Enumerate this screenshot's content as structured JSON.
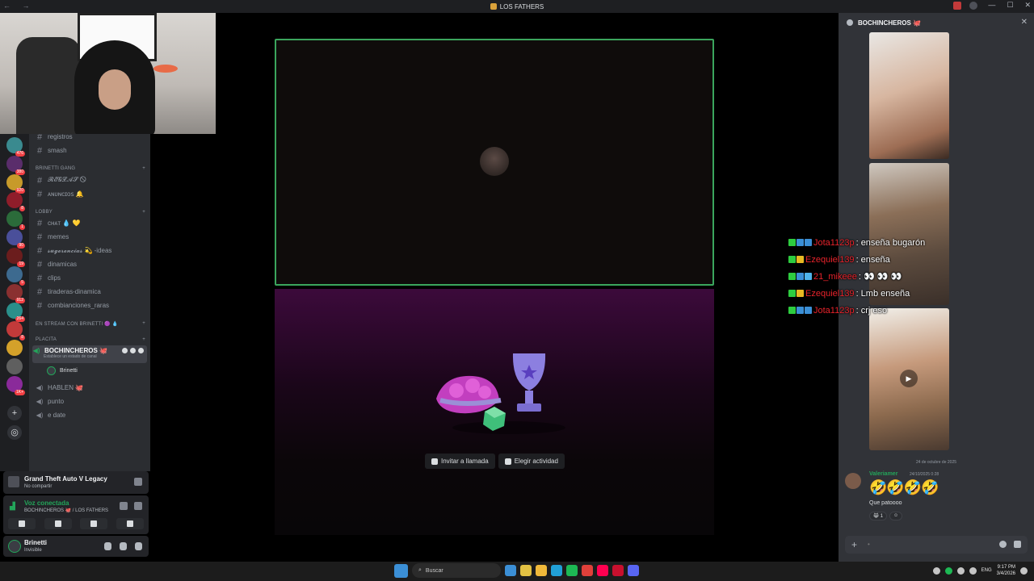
{
  "window": {
    "title": "LOS FATHERS"
  },
  "servers": [
    {
      "color": "#3a8a8f",
      "count": "476"
    },
    {
      "color": "#5a2d6b",
      "count": "380"
    },
    {
      "color": "#c79a2a",
      "count": "920"
    },
    {
      "color": "#8f1d2a",
      "count": "8"
    },
    {
      "color": "#2b6b3a",
      "count": "1"
    },
    {
      "color": "#4a4f9a",
      "count": "90"
    },
    {
      "color": "#6b1d1d",
      "count": "19"
    },
    {
      "color": "#3d6a8f",
      "count": "5"
    },
    {
      "color": "#8a3030",
      "count": "912"
    },
    {
      "color": "#2a8f8a",
      "count": "264"
    },
    {
      "color": "#c23a3a",
      "count": "8"
    },
    {
      "color": "#d4a12a",
      "count": ""
    },
    {
      "color": "#5f5f5f",
      "count": ""
    },
    {
      "color": "#8a2a9a",
      "count": "1K+"
    }
  ],
  "channels": {
    "top": [
      "registros",
      "smash"
    ],
    "cat_brinetti": "BRINETTI GANG",
    "brinetti": [
      "𝓡𝓔𝓖𝓛𝓐𝓢 🛇",
      "ᴀɴᴜɴᴄɪᴏꜱ 🔔"
    ],
    "cat_lobby": "LOBBY",
    "lobby": [
      "ᴄʜᴀᴛ 💧 💛",
      "memes",
      "𝓼𝓾𝓰𝓮𝓻𝓮𝓷𝓬𝓲𝓪𝓼 💫 -ideas",
      "dinamicas",
      "clips",
      "tiraderas-dinamica",
      "combianciones_raras"
    ],
    "cat_stream": "EN STREAM CON BRINETTI 🟣 💧",
    "cat_placita": "PLACITA",
    "active_voice": "BOCHINCHEROS 🐙",
    "active_voice_status": "Establece un estado de canal",
    "member": "Brinetti",
    "voice": [
      "HABLEN 🐙",
      "punto",
      "e date"
    ]
  },
  "activity": {
    "title": "Grand Theft Auto V Legacy",
    "sub": "No compartir"
  },
  "voice_panel": {
    "title": "Voz conectada",
    "sub": "BOCHINCHEROS 🐙 / LOS FATHERS"
  },
  "user": {
    "name": "Brinetti",
    "status": "Invisible"
  },
  "stage": {
    "invite_label": "Invitar a llamada",
    "activity_label": "Elegir actividad"
  },
  "overlay_chat": [
    {
      "user": "Jota1123p",
      "msg": ": enseña bugarón",
      "badges": [
        "#2ecc40",
        "#3b8fd6",
        "#3b8fd6"
      ]
    },
    {
      "user": "Ezequiel139",
      "msg": ": enseña",
      "badges": [
        "#2ecc40",
        "#e8b923"
      ]
    },
    {
      "user": "21_mikeee",
      "msg": ": 👀 👀 👀",
      "badges": [
        "#2ecc40",
        "#3b8fd6",
        "#4fb3ea"
      ]
    },
    {
      "user": "Ezequiel139",
      "msg": ": Lmb enseña",
      "badges": [
        "#2ecc40",
        "#e8b923"
      ]
    },
    {
      "user": "Jota1123p",
      "msg": ": crj eso",
      "badges": [
        "#2ecc40",
        "#3b8fd6",
        "#3b8fd6"
      ]
    }
  ],
  "chat": {
    "header": "BOCHINCHEROS 🐙",
    "date": "24 de octubre de 2025",
    "message": {
      "author": "Valeriamer",
      "time": "24/10/2025 0:28",
      "emoji": "🤣🤣🤣🤣",
      "text": "Que patoooo",
      "reaction_count": "1"
    },
    "input_placeholder": "•"
  },
  "taskbar": {
    "search_label": "Buscar",
    "lang": "ENG",
    "time": "9:17 PM",
    "date": "3/4/2026",
    "apps": [
      "#3b8fd6",
      "#e2c143",
      "#f0b93a",
      "#21a0d6",
      "#1db954",
      "#e0403a",
      "#ff0050",
      "#c8102e",
      "#5865f2"
    ]
  }
}
